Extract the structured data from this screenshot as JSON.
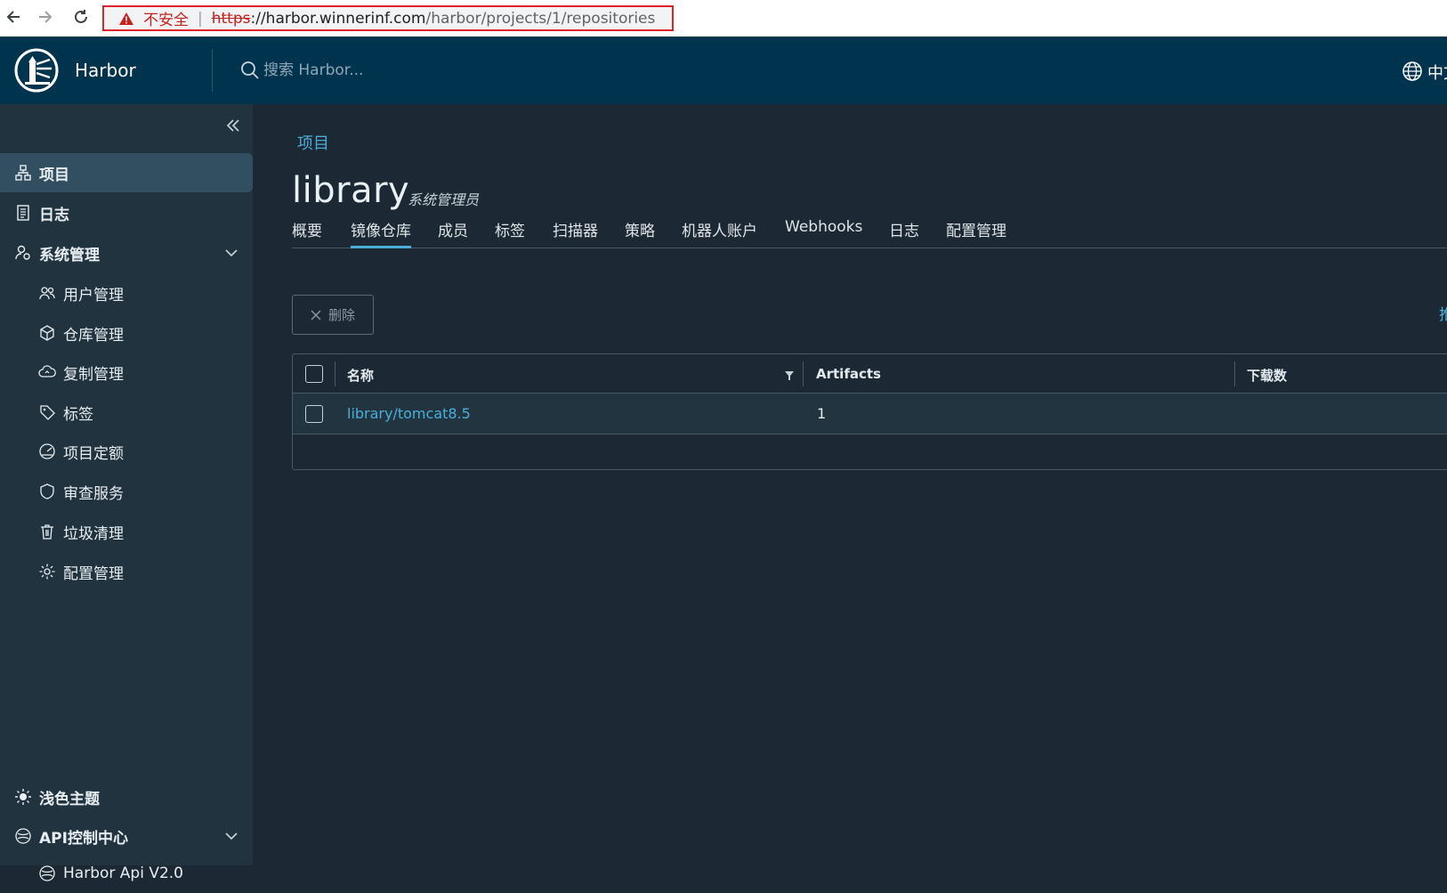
{
  "browser": {
    "security_label": "不安全",
    "url_scheme": "https",
    "url_host": "://harbor.winnerinf.com",
    "url_path": "/harbor/projects/1/repositories"
  },
  "header": {
    "app_title": "Harbor",
    "search_placeholder": "搜索 Harbor...",
    "language": "中文"
  },
  "sidebar": {
    "items": [
      {
        "label": "项目",
        "icon": "projects-icon"
      },
      {
        "label": "日志",
        "icon": "logs-icon"
      },
      {
        "label": "系统管理",
        "icon": "system-admin-icon"
      },
      {
        "label": "用户管理",
        "icon": "users-icon"
      },
      {
        "label": "仓库管理",
        "icon": "registry-icon"
      },
      {
        "label": "复制管理",
        "icon": "replication-icon"
      },
      {
        "label": "标签",
        "icon": "tag-icon"
      },
      {
        "label": "项目定额",
        "icon": "quota-icon"
      },
      {
        "label": "审查服务",
        "icon": "shield-icon"
      },
      {
        "label": "垃圾清理",
        "icon": "trash-icon"
      },
      {
        "label": "配置管理",
        "icon": "gear-icon"
      }
    ],
    "bottom": [
      {
        "label": "浅色主题",
        "icon": "sun-icon"
      },
      {
        "label": "API控制中心",
        "icon": "api-icon"
      },
      {
        "label": "Harbor Api V2.0",
        "icon": "api-sub-icon"
      }
    ]
  },
  "main": {
    "breadcrumb": "项目",
    "project_name": "library",
    "role": "系统管理员",
    "tabs": [
      "概要",
      "镜像仓库",
      "成员",
      "标签",
      "扫描器",
      "策略",
      "机器人账户",
      "Webhooks",
      "日志",
      "配置管理"
    ],
    "active_tab": "镜像仓库",
    "delete_label": "删除",
    "push_label": "推送命令",
    "table": {
      "columns": [
        "名称",
        "Artifacts",
        "下载数"
      ],
      "rows": [
        {
          "name": "library/tomcat8.5",
          "artifacts": "1",
          "pulls": ""
        }
      ]
    }
  },
  "colors": {
    "header_bg": "#00334d",
    "sidebar_bg": "#21333f",
    "main_bg": "#1c2833",
    "accent": "#49afd9",
    "active_nav": "#324f62"
  }
}
